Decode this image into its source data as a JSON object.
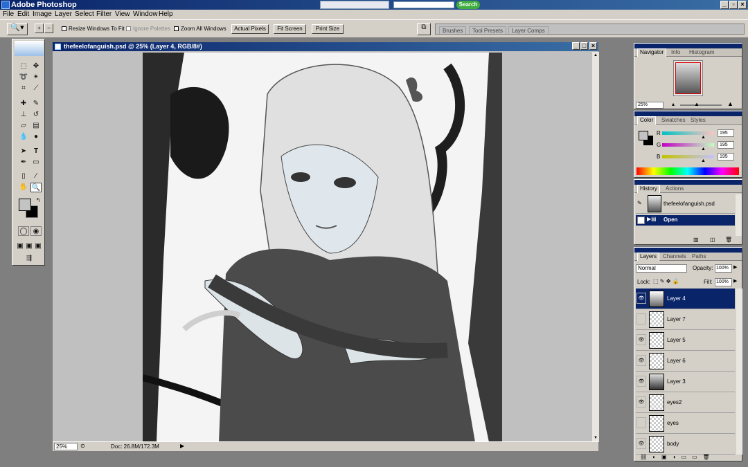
{
  "app": {
    "title": "Adobe Photoshop"
  },
  "search_bar": {
    "button_label": "Search"
  },
  "menu": [
    "File",
    "Edit",
    "Image",
    "Layer",
    "Select",
    "Filter",
    "View",
    "Window",
    "Help"
  ],
  "options_bar": {
    "resize_windows": "Resize Windows To Fit",
    "ignore_palettes": "Ignore Palettes",
    "zoom_all": "Zoom All Windows",
    "actual_pixels": "Actual Pixels",
    "fit_screen": "Fit Screen",
    "print_size": "Print Size"
  },
  "palette_well": {
    "tabs": [
      "Brushes",
      "Tool Presets",
      "Layer Comps"
    ]
  },
  "document": {
    "title": "thefeelofanguish.psd @ 25% (Layer 4, RGB/8#)",
    "zoom": "25%",
    "doc_info": "Doc: 26.8M/172.3M"
  },
  "navigator": {
    "tabs": [
      "Navigator",
      "Info",
      "Histogram"
    ],
    "zoom": "25%"
  },
  "color": {
    "tabs": [
      "Color",
      "Swatches",
      "Styles"
    ],
    "channels": [
      {
        "label": "R",
        "value": "195",
        "level": 0.765
      },
      {
        "label": "G",
        "value": "195",
        "level": 0.765
      },
      {
        "label": "B",
        "value": "195",
        "level": 0.765
      }
    ]
  },
  "history": {
    "tabs": [
      "History",
      "Actions"
    ],
    "snapshot": "thefeelofanguish.psd",
    "steps": [
      "Open"
    ]
  },
  "layers": {
    "tabs": [
      "Layers",
      "Channels",
      "Paths"
    ],
    "blend_mode": "Normal",
    "opacity_label": "Opacity:",
    "opacity": "100%",
    "lock_label": "Lock:",
    "fill_label": "Fill:",
    "fill": "100%",
    "items": [
      {
        "name": "Layer 4",
        "visible": true,
        "selected": true
      },
      {
        "name": "Layer 7",
        "visible": false,
        "selected": false
      },
      {
        "name": "Layer 5",
        "visible": true,
        "selected": false
      },
      {
        "name": "Layer 6",
        "visible": true,
        "selected": false
      },
      {
        "name": "Layer 3",
        "visible": true,
        "selected": false
      },
      {
        "name": "eyes2",
        "visible": true,
        "selected": false
      },
      {
        "name": "eyes",
        "visible": false,
        "selected": false
      },
      {
        "name": "body",
        "visible": true,
        "selected": false
      }
    ]
  }
}
